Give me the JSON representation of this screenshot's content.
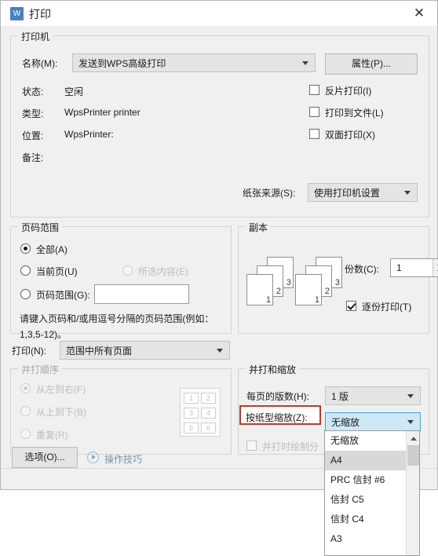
{
  "window": {
    "title": "打印",
    "logo_icon": "wps-logo-icon",
    "close_icon": "close-icon"
  },
  "printer": {
    "legend": "打印机",
    "name_label": "名称(M):",
    "name_value": "发送到WPS高级打印",
    "properties_button": "属性(P)...",
    "status_label": "状态:",
    "status_value": "空闲",
    "type_label": "类型:",
    "type_value": "WpsPrinter printer",
    "location_label": "位置:",
    "location_value": "WpsPrinter:",
    "comment_label": "备注:",
    "comment_value": "",
    "checkboxes": [
      {
        "label": "反片打印(I)",
        "checked": false
      },
      {
        "label": "打印到文件(L)",
        "checked": false
      },
      {
        "label": "双面打印(X)",
        "checked": false
      }
    ],
    "paper_source_label": "纸张来源(S):",
    "paper_source_value": "使用打印机设置"
  },
  "page_range": {
    "legend": "页码范围",
    "options": [
      {
        "label": "全部(A)",
        "selected": true,
        "disabled": false
      },
      {
        "label": "当前页(U)",
        "selected": false,
        "disabled": false
      },
      {
        "label": "所选内容(E)",
        "selected": false,
        "disabled": true
      },
      {
        "label": "页码范围(G):",
        "selected": false,
        "disabled": false
      }
    ],
    "range_input_value": "",
    "hint_line1": "请键入页码和/或用逗号分隔的页码范围(例如：",
    "hint_line2": "1,3,5-12)。"
  },
  "copies": {
    "legend": "副本",
    "count_label": "份数(C):",
    "count_value": "1",
    "collate_label": "逐份打印(T)",
    "collate_checked": true,
    "preview_page_numbers": [
      "3",
      "2",
      "1"
    ]
  },
  "print_what": {
    "label": "打印(N):",
    "value": "范围中所有页面"
  },
  "nup_order": {
    "legend": "并打顺序",
    "disabled": true,
    "options": [
      {
        "label": "从左到右(F)",
        "selected": true
      },
      {
        "label": "从上到下(B)",
        "selected": false
      },
      {
        "label": "重复(R)",
        "selected": false
      }
    ],
    "preview_cells": [
      "1",
      "2",
      "3",
      "4",
      "5",
      "6"
    ],
    "draw_sep_label": "并打时绘制分",
    "draw_sep_checked": false
  },
  "nup_scale": {
    "legend": "并打和缩放",
    "pages_per_sheet_label": "每页的版数(H):",
    "pages_per_sheet_value": "1 版",
    "scale_to_paper_label": "按纸型缩放(Z):",
    "scale_to_paper_value": "无缩放",
    "highlight_color": "#c0392b",
    "dropdown_open": true,
    "dropdown_items": [
      {
        "label": "无缩放",
        "highlighted": false
      },
      {
        "label": "A4",
        "highlighted": true
      },
      {
        "label": "PRC 信封 #6",
        "highlighted": false
      },
      {
        "label": "信封 C5",
        "highlighted": false
      },
      {
        "label": "信封 C4",
        "highlighted": false
      },
      {
        "label": "A3",
        "highlighted": false
      }
    ],
    "scroll_up_icon": "chevron-up-icon"
  },
  "footer": {
    "options_button": "选项(O)...",
    "tips_icon": "play-circle-icon",
    "tips_label": "操作技巧"
  }
}
